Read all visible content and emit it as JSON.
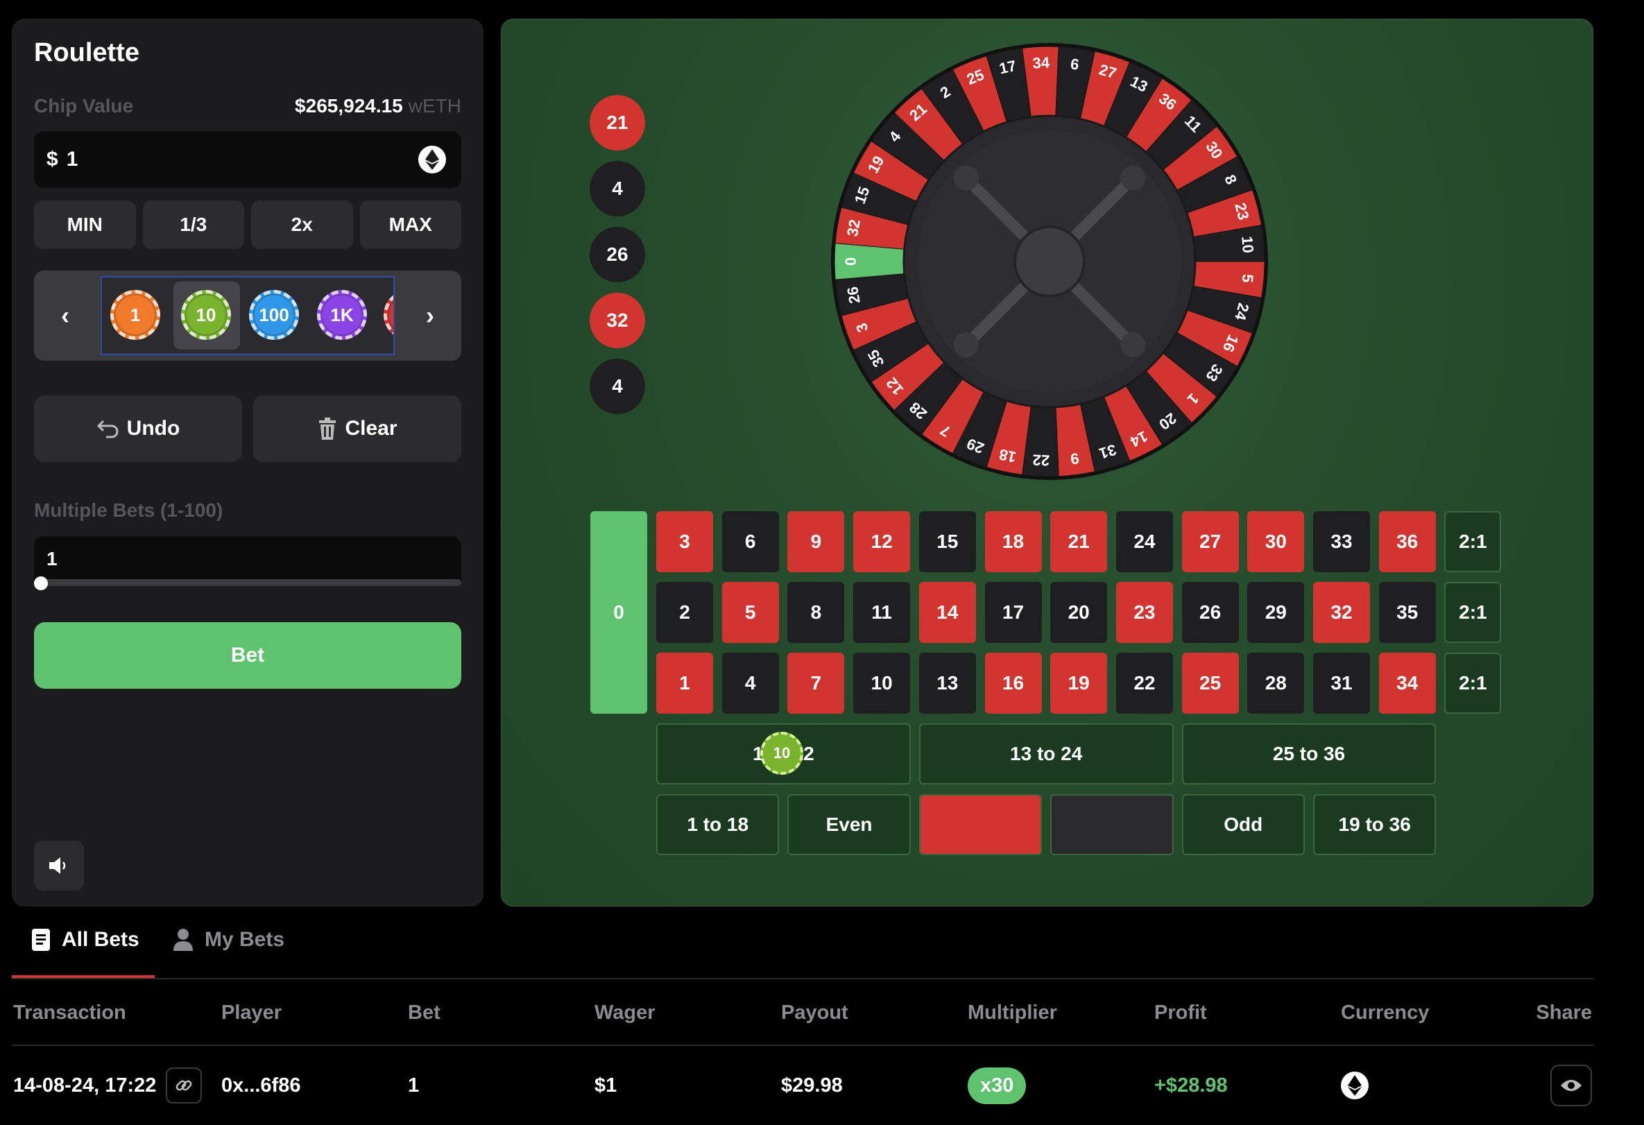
{
  "panel": {
    "title": "Roulette",
    "chip_value_label": "Chip Value",
    "balance": "$265,924.15",
    "balance_currency": "wETH",
    "amount_prefix": "$",
    "amount_value": "1",
    "quick_buttons": [
      "MIN",
      "1/3",
      "2x",
      "MAX"
    ],
    "chips": [
      {
        "label": "1",
        "color": "#f07a2a"
      },
      {
        "label": "10",
        "color": "#7ab32e"
      },
      {
        "label": "100",
        "color": "#2f97e8"
      },
      {
        "label": "1K",
        "color": "#8b45e6"
      },
      {
        "label": "",
        "color": "#d2342f"
      }
    ],
    "selected_chip": "10",
    "undo_label": "Undo",
    "clear_label": "Clear",
    "multiple_bets_label": "Multiple Bets (1-100)",
    "multiple_bets_value": "1",
    "bet_label": "Bet"
  },
  "history": [
    {
      "number": "21",
      "color": "red"
    },
    {
      "number": "4",
      "color": "black"
    },
    {
      "number": "26",
      "color": "black"
    },
    {
      "number": "32",
      "color": "red"
    },
    {
      "number": "4",
      "color": "black"
    }
  ],
  "wheel": {
    "sequence": [
      "0",
      "32",
      "15",
      "19",
      "4",
      "21",
      "2",
      "25",
      "17",
      "34",
      "6",
      "27",
      "13",
      "36",
      "11",
      "30",
      "8",
      "23",
      "10",
      "5",
      "24",
      "16",
      "33",
      "1",
      "20",
      "14",
      "31",
      "9",
      "22",
      "18",
      "29",
      "7",
      "28",
      "12",
      "35",
      "3",
      "26"
    ],
    "red_numbers": [
      1,
      3,
      5,
      7,
      9,
      12,
      14,
      16,
      18,
      19,
      21,
      23,
      25,
      27,
      30,
      32,
      34,
      36
    ]
  },
  "board": {
    "zero": "0",
    "rows": [
      [
        "3",
        "6",
        "9",
        "12",
        "15",
        "18",
        "21",
        "24",
        "27",
        "30",
        "33",
        "36"
      ],
      [
        "2",
        "5",
        "8",
        "11",
        "14",
        "17",
        "20",
        "23",
        "26",
        "29",
        "32",
        "35"
      ],
      [
        "1",
        "4",
        "7",
        "10",
        "13",
        "16",
        "19",
        "22",
        "25",
        "28",
        "31",
        "34"
      ]
    ],
    "column_bets": [
      "2:1",
      "2:1",
      "2:1"
    ],
    "dozens": [
      "1 to 12",
      "13 to 24",
      "25 to 36"
    ],
    "outside": [
      "1 to 18",
      "Even",
      "",
      "",
      "Odd",
      "19 to 36"
    ],
    "placed_chip": {
      "label": "10",
      "on": "1 to 12"
    }
  },
  "tabs": {
    "all": "All Bets",
    "my": "My Bets",
    "active": "All Bets"
  },
  "bets_table": {
    "columns": [
      "Transaction",
      "Player",
      "Bet",
      "Wager",
      "Payout",
      "Multiplier",
      "Profit",
      "Currency",
      "Share"
    ],
    "rows": [
      {
        "transaction": "14-08-24, 17:22",
        "player": "0x...6f86",
        "bet": "1",
        "wager": "$1",
        "payout": "$29.98",
        "multiplier": "x30",
        "profit": "+$28.98",
        "currency_icon": "ethereum-icon",
        "share_icon": "eye-icon"
      }
    ]
  },
  "colors": {
    "red": "#d2342f",
    "black": "#1f1f22",
    "green": "#5ec26e",
    "felt": "#244a2b",
    "profit": "#5ec26e"
  }
}
